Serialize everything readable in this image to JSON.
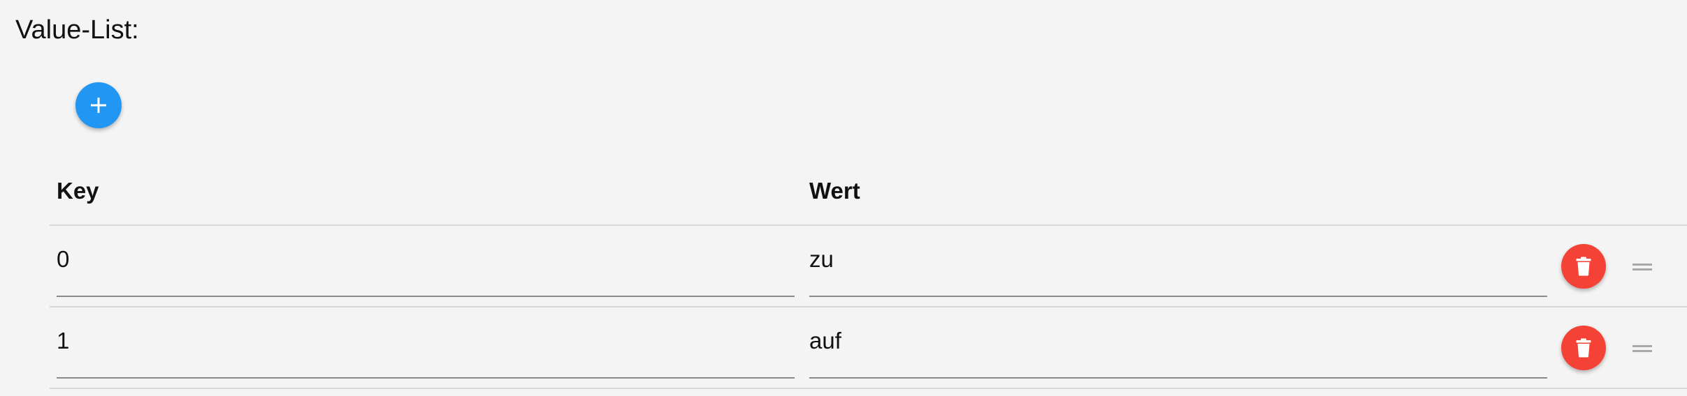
{
  "section": {
    "title": "Value-List:"
  },
  "toolbar": {
    "add_icon": "plus-icon",
    "add_color": "#2196f3"
  },
  "table": {
    "columns": [
      "Key",
      "Wert"
    ],
    "rows": [
      {
        "key": "0",
        "value": "zu"
      },
      {
        "key": "1",
        "value": "auf"
      }
    ],
    "delete_icon": "trash-icon",
    "delete_color": "#f44336",
    "drag_icon": "drag-handle-icon"
  }
}
